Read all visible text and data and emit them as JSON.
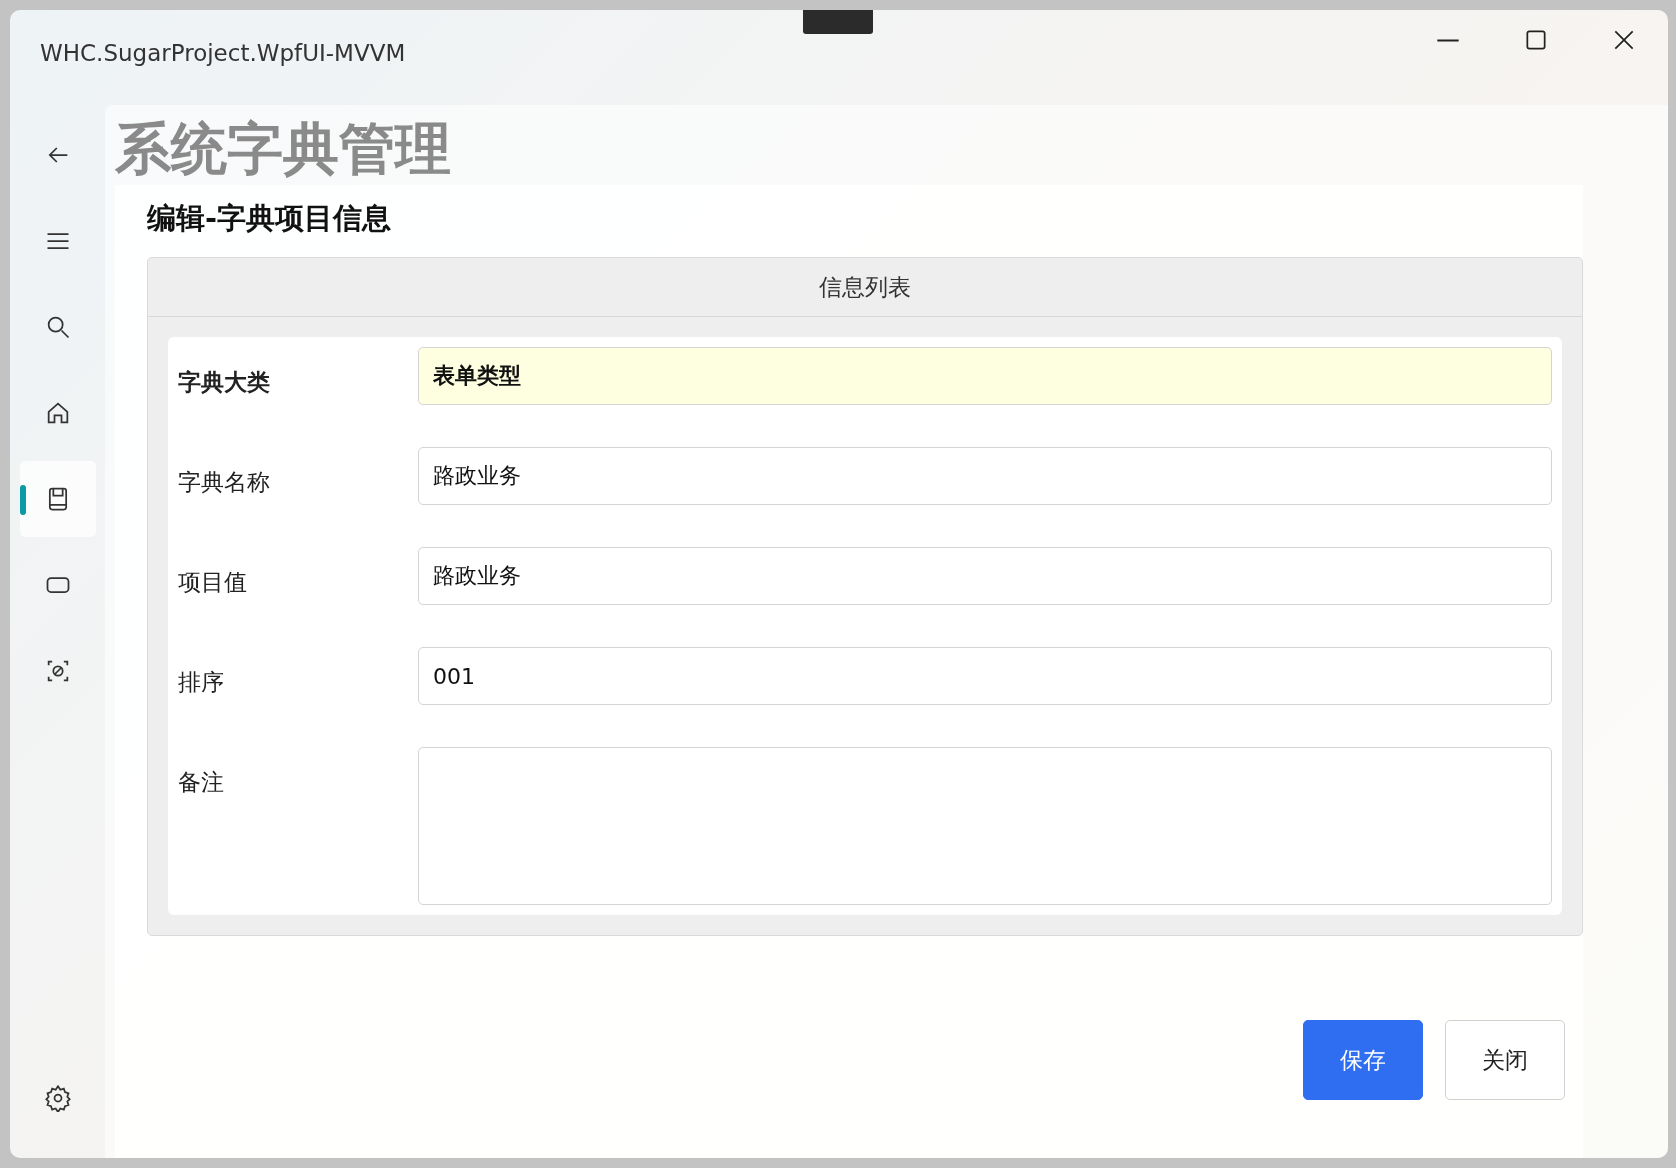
{
  "window": {
    "title": "WHC.SugarProject.WpfUI-MVVM"
  },
  "nav": {
    "items": [
      {
        "kind": "back",
        "selected": false
      },
      {
        "kind": "menu",
        "selected": false
      },
      {
        "kind": "search",
        "selected": false
      },
      {
        "kind": "home",
        "selected": false
      },
      {
        "kind": "book",
        "selected": true
      },
      {
        "kind": "rectangle",
        "selected": false
      },
      {
        "kind": "scan",
        "selected": false
      }
    ],
    "footer": [
      {
        "kind": "settings",
        "selected": false
      }
    ]
  },
  "page": {
    "title": "系统字典管理",
    "subtitle": "编辑-字典项目信息"
  },
  "panel": {
    "header": "信息列表",
    "fields": [
      {
        "label": "字典大类",
        "value": "表单类型",
        "kind": "locked"
      },
      {
        "label": "字典名称",
        "value": "路政业务",
        "kind": "text"
      },
      {
        "label": "项目值",
        "value": "路政业务",
        "kind": "text"
      },
      {
        "label": "排序",
        "value": "001",
        "kind": "text"
      },
      {
        "label": "备注",
        "kind": "multiline"
      }
    ]
  },
  "buttons": [
    {
      "label": "保存",
      "kind": "primary"
    },
    {
      "label": "关闭",
      "kind": "secondary"
    }
  ]
}
